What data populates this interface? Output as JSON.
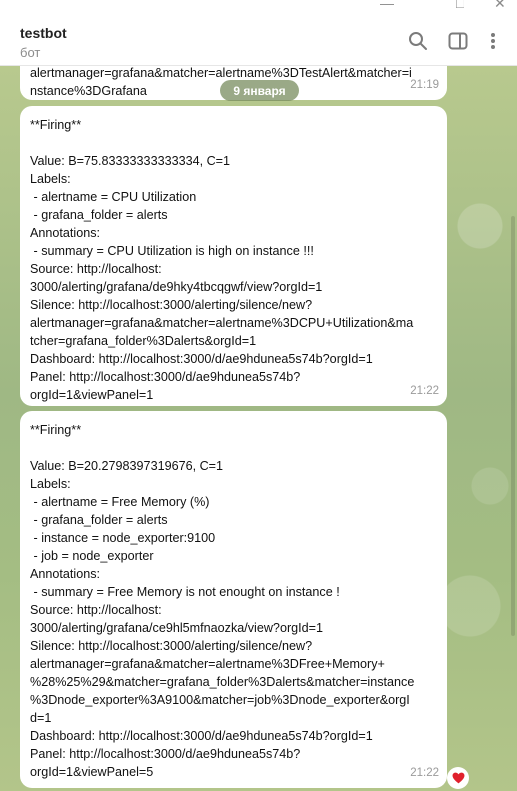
{
  "header": {
    "title": "testbot",
    "subtitle": "бот",
    "icons": [
      "search-icon",
      "sidebar-toggle-icon",
      "more-vertical-icon"
    ]
  },
  "window": {
    "controls": [
      "minimize-icon",
      "maximize-icon",
      "close-icon"
    ]
  },
  "chat": {
    "date_separator": "9 января",
    "messages": [
      {
        "lines": [
          "alertmanager=grafana&matcher=alertname%3DTestAlert&matcher=i",
          "nstance%3DGrafana"
        ],
        "time": "21:19"
      },
      {
        "lines": [
          "**Firing**",
          "",
          "Value: B=75.83333333333334, C=1",
          "Labels:",
          " - alertname = CPU Utilization",
          " - grafana_folder = alerts",
          "Annotations:",
          " - summary = CPU Utilization is high on instance !!!",
          "Source: http://localhost:",
          "3000/alerting/grafana/de9hky4tbcqgwf/view?orgId=1",
          "Silence: http://localhost:3000/alerting/silence/new?",
          "alertmanager=grafana&matcher=alertname%3DCPU+Utilization&ma",
          "tcher=grafana_folder%3Dalerts&orgId=1",
          "Dashboard: http://localhost:3000/d/ae9hdunea5s74b?orgId=1",
          "Panel: http://localhost:3000/d/ae9hdunea5s74b?",
          "orgId=1&viewPanel=1"
        ],
        "time": "21:22"
      },
      {
        "lines": [
          "**Firing**",
          "",
          "Value: B=20.2798397319676, C=1",
          "Labels:",
          " - alertname = Free Memory (%)",
          " - grafana_folder = alerts",
          " - instance = node_exporter:9100",
          " - job = node_exporter",
          "Annotations:",
          " - summary = Free Memory is not enought on instance !",
          "Source: http://localhost:",
          "3000/alerting/grafana/ce9hl5mfnaozka/view?orgId=1",
          "Silence: http://localhost:3000/alerting/silence/new?",
          "alertmanager=grafana&matcher=alertname%3DFree+Memory+",
          "%28%25%29&matcher=grafana_folder%3Dalerts&matcher=instance",
          "%3Dnode_exporter%3A9100&matcher=job%3Dnode_exporter&orgI",
          "d=1",
          "Dashboard: http://localhost:3000/d/ae9hdunea5s74b?orgId=1",
          "Panel: http://localhost:3000/d/ae9hdunea5s74b?",
          "orgId=1&viewPanel=5"
        ],
        "time": "21:22",
        "reaction": "heart-icon"
      }
    ]
  },
  "colors": {
    "chat_background": "#a9c08a",
    "bubble": "#ffffff",
    "reaction_heart": "#e0202d"
  }
}
